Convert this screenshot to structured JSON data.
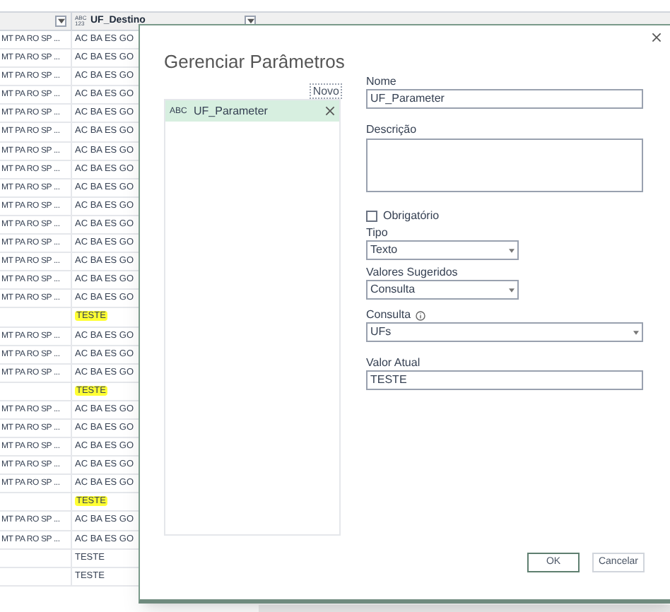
{
  "grid": {
    "column_header": {
      "type_icon": "ABC 123",
      "label": "UF_Destino"
    },
    "rows": [
      {
        "col1": "MT PA RO SP ...",
        "col2": "AC BA ES GO",
        "highlighted": false
      },
      {
        "col1": "MT PA RO SP ...",
        "col2": "AC BA ES GO",
        "highlighted": false
      },
      {
        "col1": "MT PA RO SP ...",
        "col2": "AC BA ES GO",
        "highlighted": false
      },
      {
        "col1": "MT PA RO SP ...",
        "col2": "AC BA ES GO",
        "highlighted": false
      },
      {
        "col1": "MT PA RO SP ...",
        "col2": "AC BA ES GO",
        "highlighted": false
      },
      {
        "col1": "MT PA RO SP ...",
        "col2": "AC BA ES GO",
        "highlighted": false
      },
      {
        "col1": "MT PA RO SP ...",
        "col2": "AC BA ES GO",
        "highlighted": false
      },
      {
        "col1": "MT PA RO SP ...",
        "col2": "AC BA ES GO",
        "highlighted": false
      },
      {
        "col1": "MT PA RO SP ...",
        "col2": "AC BA ES GO",
        "highlighted": false
      },
      {
        "col1": "MT PA RO SP ...",
        "col2": "AC BA ES GO",
        "highlighted": false
      },
      {
        "col1": "MT PA RO SP ...",
        "col2": "AC BA ES GO",
        "highlighted": false
      },
      {
        "col1": "MT PA RO SP ...",
        "col2": "AC BA ES GO",
        "highlighted": false
      },
      {
        "col1": "MT PA RO SP ...",
        "col2": "AC BA ES GO",
        "highlighted": false
      },
      {
        "col1": "MT PA RO SP ...",
        "col2": "AC BA ES GO",
        "highlighted": false
      },
      {
        "col1": "MT PA RO SP ...",
        "col2": "AC BA ES GO",
        "highlighted": false
      },
      {
        "col2": "TESTE",
        "highlighted": true
      },
      {
        "col1": "MT PA RO SP ...",
        "col2": "AC BA ES GO",
        "highlighted": false
      },
      {
        "col1": "MT PA RO SP ...",
        "col2": "AC BA ES GO",
        "highlighted": false
      },
      {
        "col1": "MT PA RO SP ...",
        "col2": "AC BA ES GO",
        "highlighted": false
      },
      {
        "col2": "TESTE",
        "highlighted": true
      },
      {
        "col1": "MT PA RO SP ...",
        "col2": "AC BA ES GO",
        "highlighted": false
      },
      {
        "col1": "MT PA RO SP ...",
        "col2": "AC BA ES GO",
        "highlighted": false
      },
      {
        "col1": "MT PA RO SP ...",
        "col2": "AC BA ES GO",
        "highlighted": false
      },
      {
        "col1": "MT PA RO SP ...",
        "col2": "AC BA ES GO",
        "highlighted": false
      },
      {
        "col1": "MT PA RO SP ...",
        "col2": "AC BA ES GO",
        "highlighted": false
      },
      {
        "col2": "TESTE",
        "highlighted": true
      },
      {
        "col1": "MT PA RO SP ...",
        "col2": "AC BA ES GO",
        "highlighted": false
      },
      {
        "col1": "MT PA RO SP ...",
        "col2": "AC BA ES GO",
        "highlighted": false
      },
      {
        "col2": "TESTE",
        "highlighted": false
      },
      {
        "col2": "TESTE",
        "highlighted": false
      }
    ]
  },
  "dialog": {
    "title": "Gerenciar Parâmetros",
    "new_link": "Novo",
    "parameters": [
      {
        "icon": "ABC",
        "name": "UF_Parameter",
        "selected": true
      }
    ],
    "form": {
      "name_label": "Nome",
      "name_value": "UF_Parameter",
      "description_label": "Descrição",
      "required": {
        "label": "Obrigatório",
        "checked": false
      },
      "type_label": "Tipo",
      "type_value": "Texto",
      "suggested_label": "Valores Sugeridos",
      "suggested_value": "Consulta",
      "query_label": "Consulta",
      "query_value": "UFs",
      "current_label": "Valor Atual",
      "current_value": "TESTE"
    },
    "buttons": [
      {
        "label": "OK",
        "primary": true
      },
      {
        "label": "Cancelar",
        "primary": false
      }
    ]
  }
}
